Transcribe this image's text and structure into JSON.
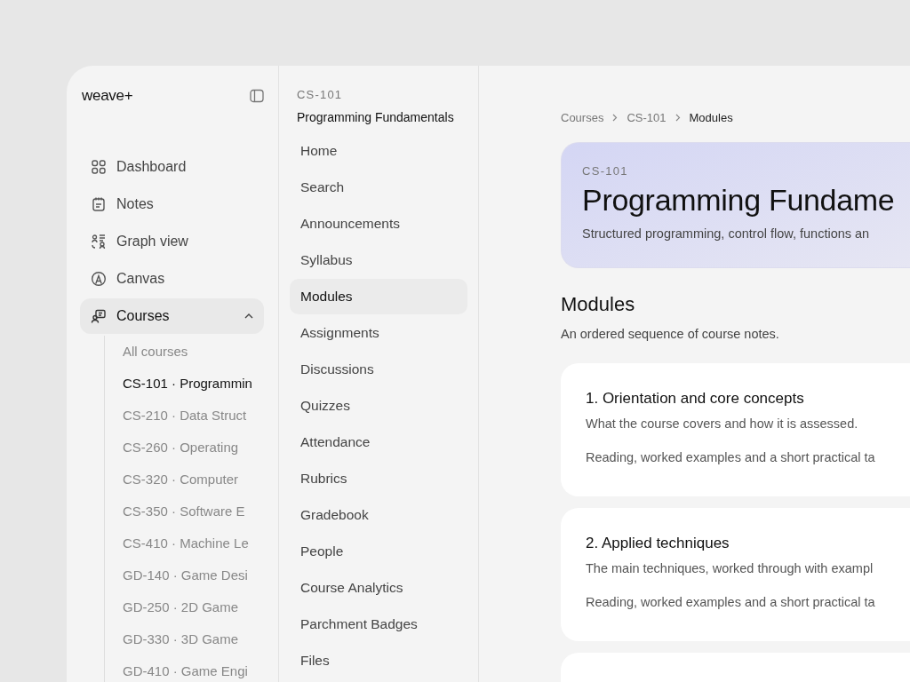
{
  "sidebar": {
    "logo": "weave+",
    "nav": [
      {
        "label": "Dashboard",
        "selected": false
      },
      {
        "label": "Notes",
        "selected": false
      },
      {
        "label": "Graph view",
        "selected": false
      },
      {
        "label": "Canvas",
        "selected": false
      },
      {
        "label": "Courses",
        "selected": true,
        "expanded": true
      }
    ],
    "courses": [
      {
        "label": "All courses",
        "selected": false
      },
      {
        "label": "CS-101 · Programmin",
        "selected": true
      },
      {
        "label": "CS-210 · Data Struct",
        "selected": false
      },
      {
        "label": "CS-260 · Operating",
        "selected": false
      },
      {
        "label": "CS-320 · Computer",
        "selected": false
      },
      {
        "label": "CS-350 · Software E",
        "selected": false
      },
      {
        "label": "CS-410 · Machine Le",
        "selected": false
      },
      {
        "label": "GD-140 · Game Desi",
        "selected": false
      },
      {
        "label": "GD-250 · 2D Game",
        "selected": false
      },
      {
        "label": "GD-330 · 3D Game",
        "selected": false
      },
      {
        "label": "GD-410 · Game Engi",
        "selected": false
      }
    ]
  },
  "course_menu": {
    "code": "CS-101",
    "title": "Programming Fundamentals",
    "items": [
      {
        "label": "Home",
        "selected": false
      },
      {
        "label": "Search",
        "selected": false
      },
      {
        "label": "Announcements",
        "selected": false
      },
      {
        "label": "Syllabus",
        "selected": false
      },
      {
        "label": "Modules",
        "selected": true
      },
      {
        "label": "Assignments",
        "selected": false
      },
      {
        "label": "Discussions",
        "selected": false
      },
      {
        "label": "Quizzes",
        "selected": false
      },
      {
        "label": "Attendance",
        "selected": false
      },
      {
        "label": "Rubrics",
        "selected": false
      },
      {
        "label": "Gradebook",
        "selected": false
      },
      {
        "label": "People",
        "selected": false
      },
      {
        "label": "Course Analytics",
        "selected": false
      },
      {
        "label": "Parchment Badges",
        "selected": false
      },
      {
        "label": "Files",
        "selected": false
      }
    ]
  },
  "breadcrumb": [
    "Courses",
    "CS-101",
    "Modules"
  ],
  "hero": {
    "code": "CS-101",
    "title": "Programming Fundame",
    "subtitle": "Structured programming, control flow, functions an"
  },
  "section": {
    "title": "Modules",
    "subtitle": "An ordered sequence of course notes."
  },
  "modules": [
    {
      "kind": "full",
      "title": "1. Orientation and core concepts",
      "summary": "What the course covers and how it is assessed.",
      "detail": "Reading, worked examples and a short practical ta"
    },
    {
      "kind": "full",
      "title": "2. Applied techniques",
      "summary": "The main techniques, worked through with exampl",
      "detail": "Reading, worked examples and a short practical ta"
    },
    {
      "kind": "empty"
    }
  ]
}
